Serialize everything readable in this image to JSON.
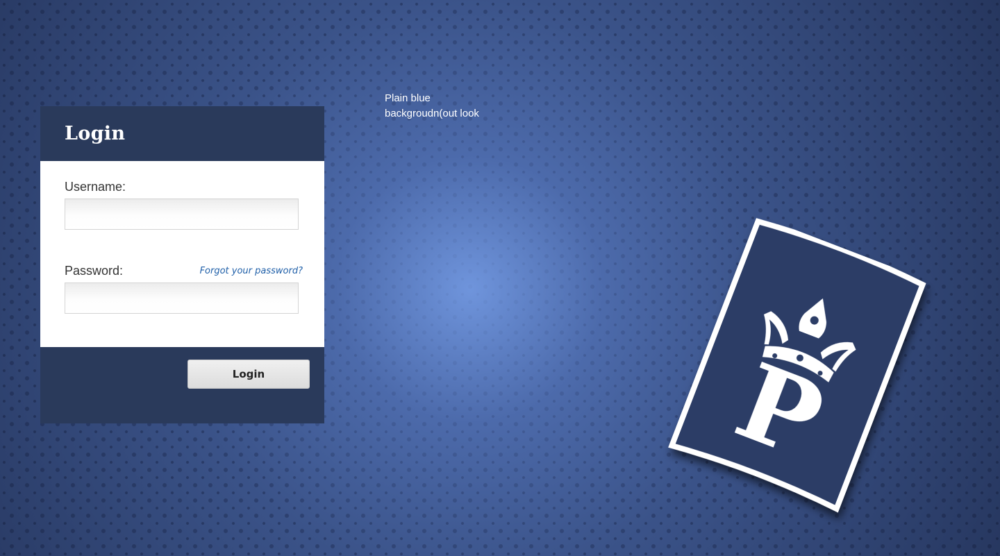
{
  "annotation": {
    "line1": "Plain blue",
    "line2": "backgroudn(out look"
  },
  "login": {
    "title": "Login",
    "username_label": "Username:",
    "username_value": "",
    "password_label": "Password:",
    "password_value": "",
    "forgot_link": "Forgot your password?",
    "button_label": "Login"
  },
  "logo": {
    "icon": "crowned-letter-p-logo",
    "letter": "P"
  },
  "colors": {
    "background": "#3c5488",
    "panel_dark": "#2a3a5b",
    "panel_body": "#ffffff",
    "link": "#1f5fa8"
  }
}
